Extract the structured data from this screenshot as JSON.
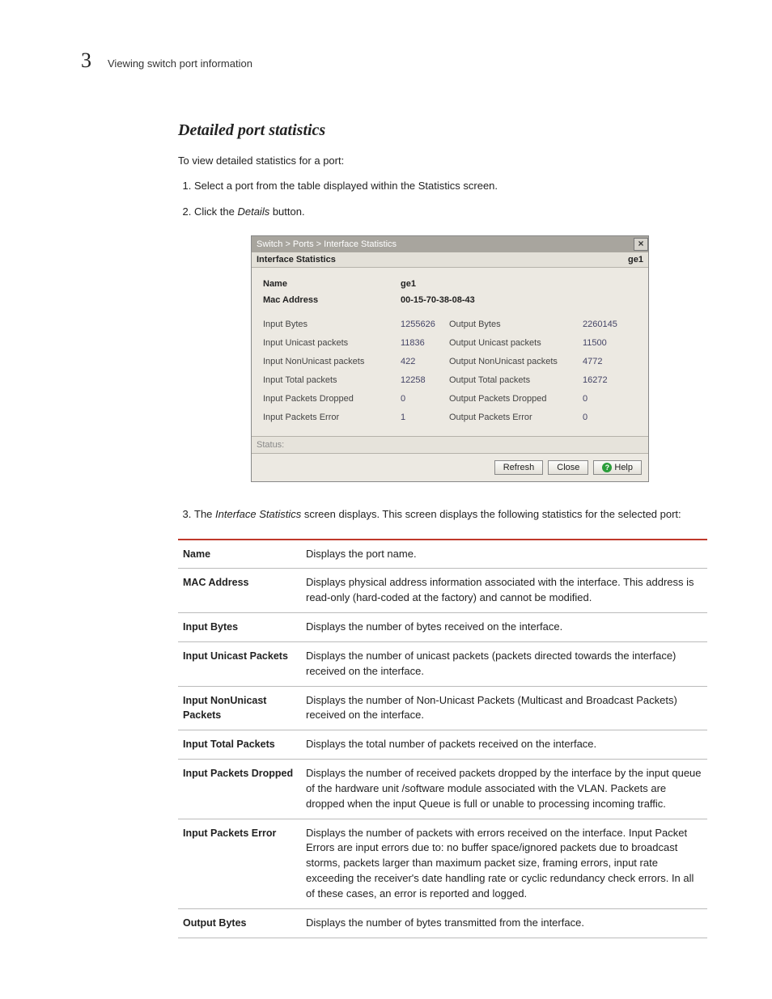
{
  "header": {
    "page_number": "3",
    "title": "Viewing switch port information"
  },
  "section": {
    "title": "Detailed port statistics",
    "intro": "To view detailed statistics for a port:",
    "step1": "Select a port from the table displayed within the Statistics screen.",
    "step2_pre": "Click the ",
    "step2_em": "Details",
    "step2_post": " button.",
    "step3_pre": "The ",
    "step3_em": "Interface Statistics",
    "step3_post": " screen displays. This screen displays the following statistics for the selected port:"
  },
  "dialog": {
    "breadcrumb": "Switch > Ports > Interface Statistics",
    "panel_title": "Interface Statistics",
    "panel_title_right": "ge1",
    "name_label": "Name",
    "name_value": "ge1",
    "mac_label": "Mac Address",
    "mac_value": "00-15-70-38-08-43",
    "rows": [
      {
        "l1": "Input Bytes",
        "v1": "1255626",
        "l2": "Output Bytes",
        "v2": "2260145"
      },
      {
        "l1": "Input Unicast packets",
        "v1": "11836",
        "l2": "Output Unicast packets",
        "v2": "11500"
      },
      {
        "l1": "Input NonUnicast packets",
        "v1": "422",
        "l2": "Output NonUnicast packets",
        "v2": "4772"
      },
      {
        "l1": "Input Total packets",
        "v1": "12258",
        "l2": "Output Total packets",
        "v2": "16272"
      },
      {
        "l1": "Input Packets Dropped",
        "v1": "0",
        "l2": "Output Packets Dropped",
        "v2": "0"
      },
      {
        "l1": "Input Packets Error",
        "v1": "1",
        "l2": "Output Packets Error",
        "v2": "0"
      }
    ],
    "status_label": "Status:",
    "btn_refresh": "Refresh",
    "btn_close": "Close",
    "btn_help": "Help"
  },
  "defs": [
    {
      "term": "Name",
      "desc": "Displays the port name."
    },
    {
      "term": "MAC Address",
      "desc": "Displays physical address information associated with the interface. This address is read-only (hard-coded at the factory) and cannot be modified."
    },
    {
      "term": "Input Bytes",
      "desc": "Displays the number of bytes received on the interface."
    },
    {
      "term": "Input Unicast Packets",
      "desc": "Displays the number of unicast packets (packets directed towards the interface) received on the interface."
    },
    {
      "term": "Input NonUnicast Packets",
      "desc": "Displays the number of Non-Unicast Packets (Multicast and Broadcast Packets) received on the interface."
    },
    {
      "term": "Input Total Packets",
      "desc": "Displays the total number of packets received on the interface."
    },
    {
      "term": "Input Packets Dropped",
      "desc": "Displays the number of received packets dropped by the interface by the input queue of the hardware unit /software module associated with the VLAN. Packets are dropped when the input Queue is full or unable to processing incoming traffic."
    },
    {
      "term": "Input Packets Error",
      "desc": "Displays the number of packets with errors received on the interface. Input Packet Errors are input errors due to: no buffer space/ignored packets due to broadcast storms, packets larger than maximum packet size, framing errors, input rate exceeding the receiver's date handling rate or cyclic redundancy check errors. In all of these cases, an error is reported and logged."
    },
    {
      "term": "Output Bytes",
      "desc": "Displays the number of bytes transmitted from the interface."
    }
  ]
}
